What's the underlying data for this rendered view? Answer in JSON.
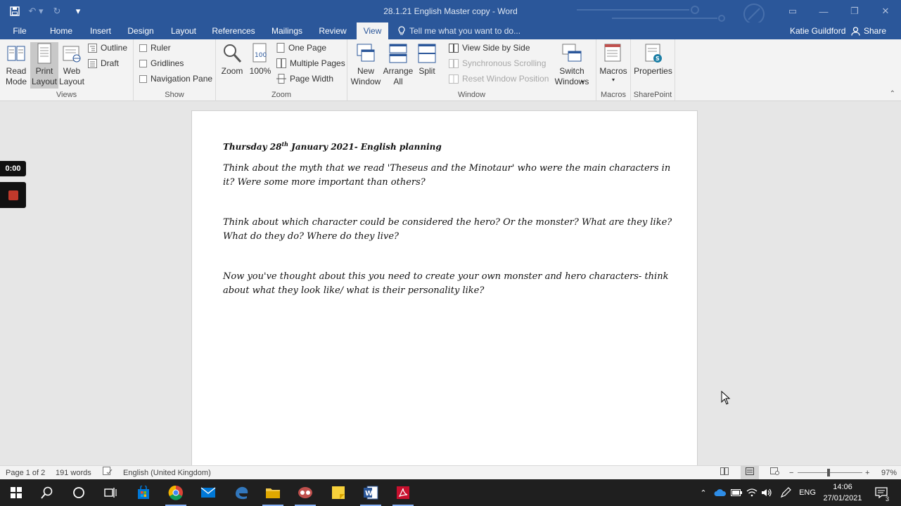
{
  "window": {
    "title": "28.1.21 English Master copy - Word"
  },
  "tabs": [
    {
      "label": "File"
    },
    {
      "label": "Home"
    },
    {
      "label": "Insert"
    },
    {
      "label": "Design"
    },
    {
      "label": "Layout"
    },
    {
      "label": "References"
    },
    {
      "label": "Mailings"
    },
    {
      "label": "Review"
    },
    {
      "label": "View"
    }
  ],
  "active_tab": "View",
  "tell_me": "Tell me what you want to do...",
  "user": {
    "name": "Katie Guildford",
    "share_label": "Share"
  },
  "ribbon": {
    "views": {
      "label": "Views",
      "read_mode": "Read Mode",
      "print_layout": "Print Layout",
      "web_layout": "Web Layout",
      "outline": "Outline",
      "draft": "Draft"
    },
    "show": {
      "label": "Show",
      "ruler": "Ruler",
      "gridlines": "Gridlines",
      "navigation_pane": "Navigation Pane"
    },
    "zoom": {
      "label": "Zoom",
      "zoom": "Zoom",
      "hundred": "100%",
      "one_page": "One Page",
      "multiple_pages": "Multiple Pages",
      "page_width": "Page Width"
    },
    "window": {
      "label": "Window",
      "new_window": "New Window",
      "arrange_all": "Arrange All",
      "split": "Split",
      "side_by_side": "View Side by Side",
      "sync_scrolling": "Synchronous Scrolling",
      "reset_position": "Reset Window Position",
      "switch_windows": "Switch Windows"
    },
    "macros": {
      "label": "Macros",
      "macros": "Macros"
    },
    "sharepoint": {
      "label": "SharePoint",
      "properties": "Properties"
    }
  },
  "document": {
    "heading_pre": "Thursday 28",
    "heading_sup": "th",
    "heading_post": " January 2021- English planning",
    "paragraphs": [
      "Think about the myth that we read 'Theseus and the Minotaur' who were the main characters in it? Were some more important than others?",
      "Think about which character could be considered the hero? Or the monster? What are they like? What do they do? Where do they live?",
      "Now you've thought about this you need to create your own monster and hero characters- think about what they look like/ what is their personality like?"
    ]
  },
  "recording": {
    "timer": "0:00"
  },
  "status": {
    "page": "Page 1 of 2",
    "words": "191 words",
    "language": "English (United Kingdom)",
    "zoom": "97%",
    "zoom_fraction": 0.48
  },
  "taskbar": {
    "language": "ENG",
    "time": "14:06",
    "date": "27/01/2021",
    "notifications": "3"
  }
}
